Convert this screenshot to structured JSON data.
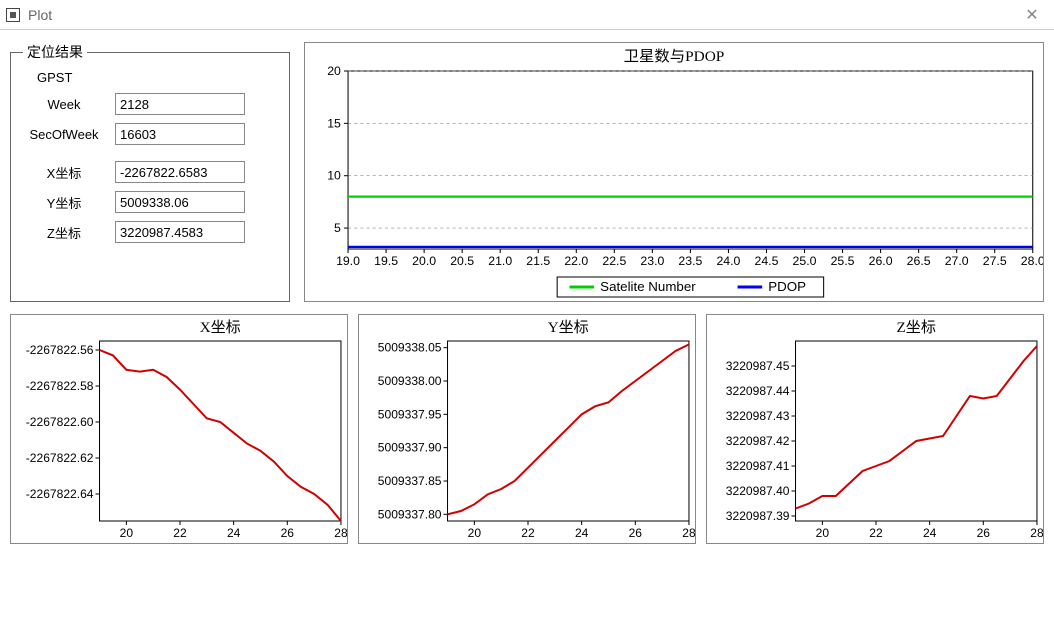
{
  "window": {
    "title": "Plot"
  },
  "form": {
    "legend": "定位结果",
    "gpst_label": "GPST",
    "week_label": "Week",
    "week_value": "2128",
    "sow_label": "SecOfWeek",
    "sow_value": "16603",
    "x_label": "X坐标",
    "x_value": "-2267822.6583",
    "y_label": "Y坐标",
    "y_value": "5009338.06",
    "z_label": "Z坐标",
    "z_value": "3220987.4583"
  },
  "chart_data": [
    {
      "id": "top",
      "type": "line",
      "title": "卫星数与PDOP",
      "x": [
        19.0,
        28.0
      ],
      "x_ticks": [
        "19.0",
        "19.5",
        "20.0",
        "20.5",
        "21.0",
        "21.5",
        "22.0",
        "22.5",
        "23.0",
        "23.5",
        "24.0",
        "24.5",
        "25.0",
        "25.5",
        "26.0",
        "26.5",
        "27.0",
        "27.5",
        "28.0"
      ],
      "y_ticks": [
        5,
        10,
        15,
        20
      ],
      "ylim": [
        3,
        20
      ],
      "xlim": [
        19.0,
        28.0
      ],
      "series": [
        {
          "name": "Satelite Number",
          "color": "#00d000",
          "style": "constant",
          "value": 8
        },
        {
          "name": "PDOP",
          "color": "#0000ff",
          "style": "constant",
          "value": 3.2
        }
      ],
      "legend": [
        "Satelite Number",
        "PDOP"
      ]
    },
    {
      "id": "x",
      "type": "line",
      "title": "X坐标",
      "xlim": [
        19,
        28
      ],
      "x_ticks": [
        20,
        22,
        24,
        26,
        28
      ],
      "y_ticks_labels": [
        "-2267822.56",
        "-2267822.58",
        "-2267822.60",
        "-2267822.62",
        "-2267822.64"
      ],
      "ylim": [
        -2267822.655,
        -2267822.555
      ],
      "series": [
        {
          "name": "X",
          "color": "#d00000",
          "x": [
            19.0,
            19.5,
            20.0,
            20.5,
            21.0,
            21.5,
            22.0,
            22.5,
            23.0,
            23.5,
            24.0,
            24.5,
            25.0,
            25.5,
            26.0,
            26.5,
            27.0,
            27.5,
            28.0
          ],
          "y": [
            -2267822.56,
            -2267822.563,
            -2267822.571,
            -2267822.572,
            -2267822.571,
            -2267822.575,
            -2267822.582,
            -2267822.59,
            -2267822.598,
            -2267822.6,
            -2267822.606,
            -2267822.612,
            -2267822.616,
            -2267822.622,
            -2267822.63,
            -2267822.636,
            -2267822.64,
            -2267822.646,
            -2267822.655
          ]
        }
      ]
    },
    {
      "id": "y",
      "type": "line",
      "title": "Y坐标",
      "xlim": [
        19,
        28
      ],
      "x_ticks": [
        20,
        22,
        24,
        26,
        28
      ],
      "y_ticks_labels": [
        "5009338.05",
        "5009338.00",
        "5009337.95",
        "5009337.90",
        "5009337.85",
        "5009337.80"
      ],
      "ylim": [
        5009337.79,
        5009338.06
      ],
      "series": [
        {
          "name": "Y",
          "color": "#d00000",
          "x": [
            19.0,
            19.5,
            20.0,
            20.5,
            21.0,
            21.5,
            22.0,
            22.5,
            23.0,
            23.5,
            24.0,
            24.5,
            25.0,
            25.5,
            26.0,
            26.5,
            27.0,
            27.5,
            28.0
          ],
          "y": [
            5009337.8,
            5009337.805,
            5009337.815,
            5009337.83,
            5009337.838,
            5009337.85,
            5009337.87,
            5009337.89,
            5009337.91,
            5009337.93,
            5009337.95,
            5009337.962,
            5009337.968,
            5009337.985,
            5009338.0,
            5009338.015,
            5009338.03,
            5009338.045,
            5009338.055
          ]
        }
      ]
    },
    {
      "id": "z",
      "type": "line",
      "title": "Z坐标",
      "xlim": [
        19,
        28
      ],
      "x_ticks": [
        20,
        22,
        24,
        26,
        28
      ],
      "y_ticks_labels": [
        "3220987.45",
        "3220987.44",
        "3220987.43",
        "3220987.42",
        "3220987.41",
        "3220987.40",
        "3220987.39"
      ],
      "ylim": [
        3220987.388,
        3220987.46
      ],
      "series": [
        {
          "name": "Z",
          "color": "#d00000",
          "x": [
            19.0,
            19.5,
            20.0,
            20.5,
            21.0,
            21.5,
            22.0,
            22.5,
            23.0,
            23.5,
            24.0,
            24.5,
            25.0,
            25.5,
            26.0,
            26.5,
            27.0,
            27.5,
            28.0
          ],
          "y": [
            3220987.393,
            3220987.395,
            3220987.398,
            3220987.398,
            3220987.403,
            3220987.408,
            3220987.41,
            3220987.412,
            3220987.416,
            3220987.42,
            3220987.421,
            3220987.422,
            3220987.43,
            3220987.438,
            3220987.437,
            3220987.438,
            3220987.445,
            3220987.452,
            3220987.458
          ]
        }
      ]
    }
  ]
}
